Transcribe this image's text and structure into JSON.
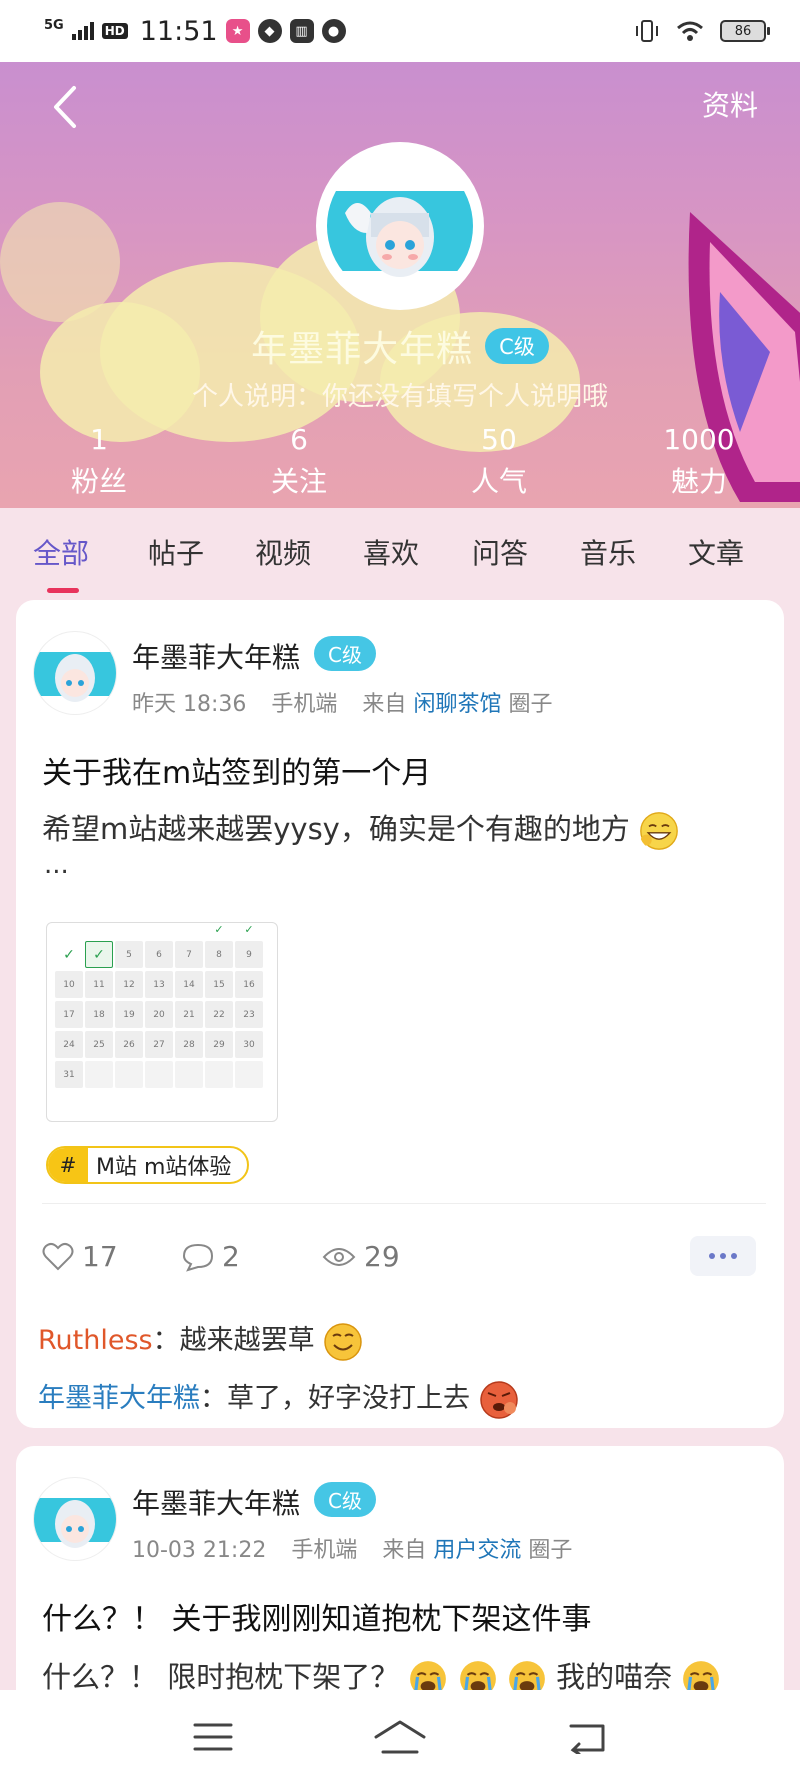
{
  "status_bar": {
    "network": "5G",
    "hd": "HD",
    "time": "11:51",
    "battery": "86"
  },
  "header": {
    "profile_link": "资料",
    "username": "年墨菲大年糕",
    "level": "C级",
    "bio": "个人说明：你还没有填写个人说明哦",
    "stats": [
      {
        "value": "1",
        "label": "粉丝"
      },
      {
        "value": "6",
        "label": "关注"
      },
      {
        "value": "50",
        "label": "人气"
      },
      {
        "value": "1000",
        "label": "魅力"
      }
    ]
  },
  "tabs": [
    "全部",
    "帖子",
    "视频",
    "喜欢",
    "问答",
    "音乐",
    "文章"
  ],
  "active_tab": "全部",
  "posts": [
    {
      "author": "年墨菲大年糕",
      "level": "C级",
      "time": "昨天 18:36",
      "device": "手机端",
      "from_label": "来自",
      "circle": "闲聊茶馆",
      "circle_suffix": "圈子",
      "title": "关于我在m站签到的第一个月",
      "body": "希望m站越来越罢yysy，确实是个有趣的地方",
      "ellipsis": "...",
      "calendar_days": [
        "5",
        "6",
        "7",
        "8",
        "9",
        "10",
        "11",
        "12",
        "13",
        "14",
        "15",
        "16",
        "17",
        "18",
        "19",
        "20",
        "21",
        "22",
        "23",
        "24",
        "25",
        "26",
        "27",
        "28",
        "29",
        "30",
        "31"
      ],
      "topic_hash": "#",
      "topic": "M站  m站体验",
      "likes": "17",
      "comments": "2",
      "views": "29",
      "replies": [
        {
          "user": "Ruthless",
          "text": "：越来越罢草"
        },
        {
          "user": "年墨菲大年糕",
          "text": "：草了，好字没打上去"
        }
      ]
    },
    {
      "author": "年墨菲大年糕",
      "level": "C级",
      "time": "10-03 21:22",
      "device": "手机端",
      "from_label": "来自",
      "circle": "用户交流",
      "circle_suffix": "圈子",
      "title": "什么？！ 关于我刚刚知道抱枕下架这件事",
      "body_start": "什么？！ 限时抱枕下架了？",
      "body_end": "我的喵奈"
    }
  ],
  "colors": {
    "accent_tab": "#6657c9",
    "tab_underline": "#e8335c",
    "level_badge": "#45c6e5",
    "circle_link": "#1f76b8",
    "reply_user_a": "#e0572a",
    "reply_user_b": "#2a7dbf",
    "topic_yellow": "#f7c515"
  }
}
